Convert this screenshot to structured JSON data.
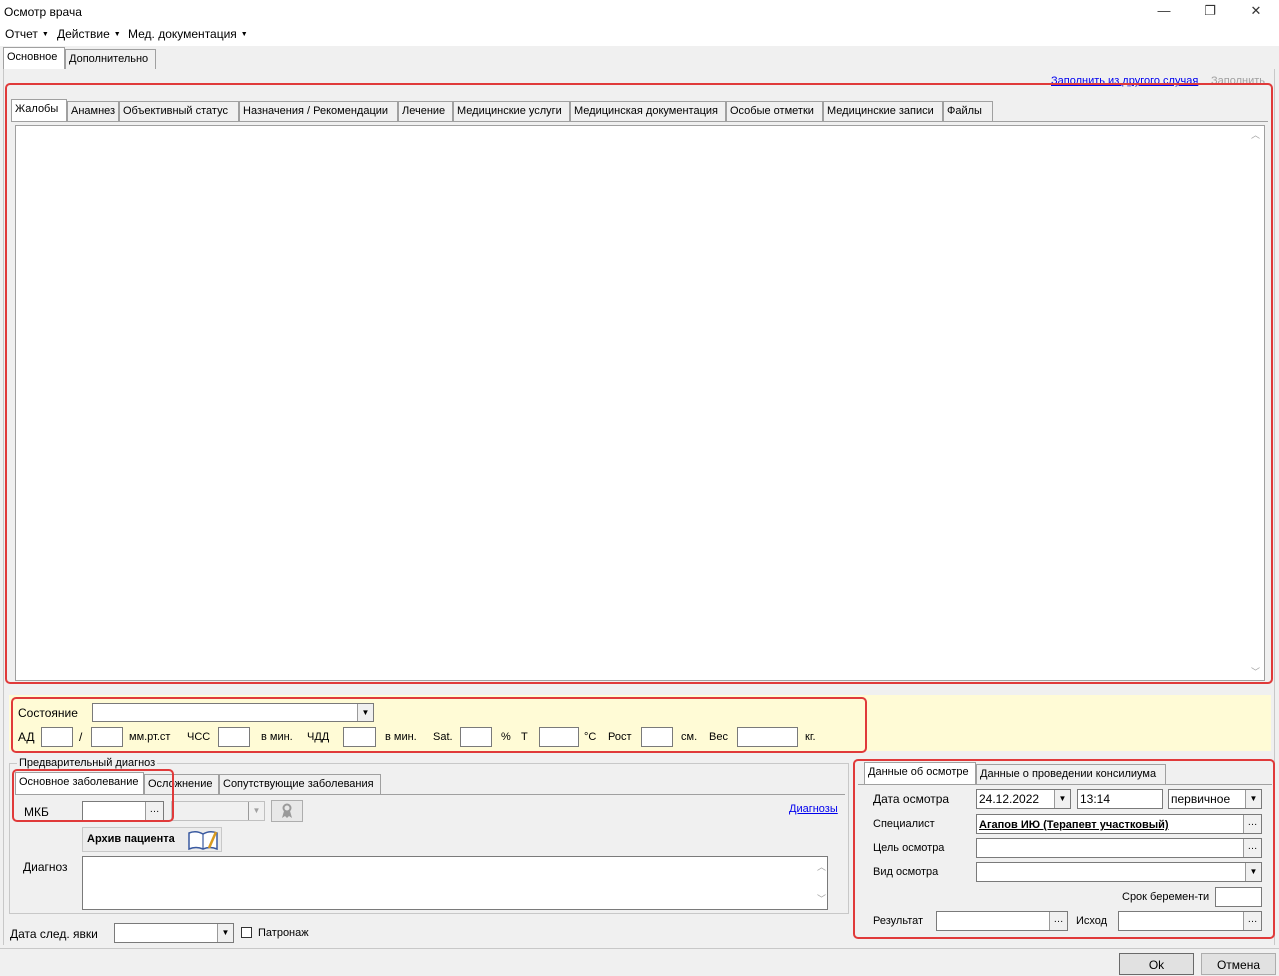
{
  "window": {
    "title": "Осмотр врача",
    "controls": [
      "—",
      "❐",
      "✕"
    ]
  },
  "menu": {
    "items": [
      {
        "label": "Отчет"
      },
      {
        "label": "Действие"
      },
      {
        "label": "Мед. документация"
      }
    ],
    "arrow": "▼"
  },
  "top_tabs": [
    {
      "label": "Основное",
      "active": true
    },
    {
      "label": "Дополнительно",
      "active": false
    }
  ],
  "links": {
    "fill_from_other": "Заполнить из другого случая",
    "fill": "Заполнить"
  },
  "inner_tabs": [
    "Жалобы",
    "Анамнез",
    "Объективный статус",
    "Назначения / Рекомендации",
    "Лечение",
    "Медицинские услуги",
    "Медицинская документация",
    "Особые отметки",
    "Медицинские записи",
    "Файлы"
  ],
  "vitals": {
    "state_label": "Состояние",
    "ad_label": "АД",
    "slash": "/",
    "mmhg": "мм.рт.ст",
    "hr_label": "ЧСС",
    "per_min": "в мин.",
    "rr_label": "ЧДД",
    "per_min2": "в мин.",
    "sat_label": "Sat.",
    "percent": "%",
    "t_label": "Т",
    "celsius": "°С",
    "height_label": "Рост",
    "cm": "см.",
    "weight_label": "Вес",
    "kg": "кг."
  },
  "diagnosis": {
    "group_label": "Предварительный диагноз",
    "tabs": [
      "Основное заболевание",
      "Осложнение",
      "Сопутствующие заболевания"
    ],
    "mkb_label": "МКБ",
    "diagnoses_link": "Диагнозы",
    "archive_label": "Архив пациента",
    "diag_label": "Диагноз"
  },
  "bottom": {
    "next_visit_label": "Дата след. явки",
    "patronage_label": "Патронаж"
  },
  "exam": {
    "tabs": [
      "Данные об осмотре",
      "Данные о проведении консилиума"
    ],
    "date_label": "Дата осмотра",
    "date_value": "24.12.2022",
    "time_value": "13:14",
    "visit_type_value": "первичное",
    "specialist_label": "Специалист",
    "specialist_value": "Агапов ИЮ (Терапевт участковый)",
    "purpose_label": "Цель осмотра",
    "kind_label": "Вид осмотра",
    "pregnancy_label": "Срок беремен-ти",
    "result_label": "Результат",
    "outcome_label": "Исход"
  },
  "buttons": {
    "ok": "Ok",
    "cancel": "Отмена"
  }
}
